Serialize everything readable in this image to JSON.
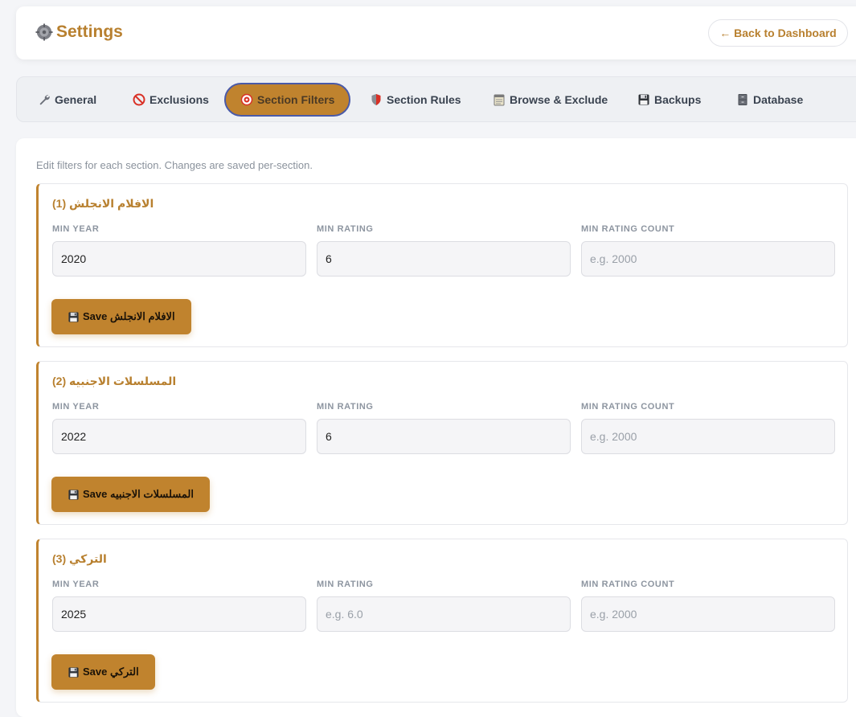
{
  "header": {
    "title": "Settings",
    "back_label": "← Back to Dashboard"
  },
  "tabs": [
    {
      "label": "General",
      "icon": "wrench-icon"
    },
    {
      "label": "Exclusions",
      "icon": "prohibited-icon"
    },
    {
      "label": "Section Filters",
      "icon": "target-icon",
      "active": true
    },
    {
      "label": "Section Rules",
      "icon": "shield-icon"
    },
    {
      "label": "Browse & Exclude",
      "icon": "notepad-icon"
    },
    {
      "label": "Backups",
      "icon": "floppy-icon"
    },
    {
      "label": "Database",
      "icon": "cabinet-icon"
    }
  ],
  "intro": "Edit filters for each section. Changes are saved per-section.",
  "field_labels": {
    "min_year": "MIN YEAR",
    "min_rating": "MIN RATING",
    "min_rating_count": "MIN RATING COUNT"
  },
  "sections": [
    {
      "title": "الافلام الانجلش (1)",
      "min_year": "2020",
      "min_rating": "6",
      "min_rating_placeholder": "",
      "min_rating_count": "",
      "min_rating_count_placeholder": "e.g. 2000",
      "save_label": "Save الافلام الانجلش"
    },
    {
      "title": "المسلسلات الاجنبيه (2)",
      "min_year": "2022",
      "min_rating": "6",
      "min_rating_placeholder": "",
      "min_rating_count": "",
      "min_rating_count_placeholder": "e.g. 2000",
      "save_label": "Save المسلسلات الاجنبيه"
    },
    {
      "title": "التركي (3)",
      "min_year": "2025",
      "min_rating": "",
      "min_rating_placeholder": "e.g. 6.0",
      "min_rating_count": "",
      "min_rating_count_placeholder": "e.g. 2000",
      "save_label": "Save التركي"
    }
  ],
  "colors": {
    "accent": "#c0832e",
    "title": "#b8802f",
    "active_tab_border": "#4a5aa8",
    "background": "#f4f5f8"
  }
}
